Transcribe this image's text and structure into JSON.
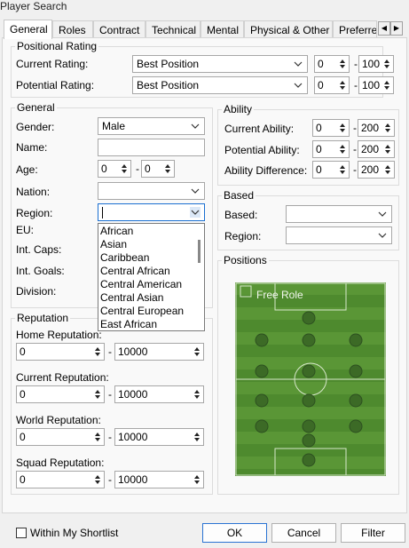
{
  "window": {
    "title": "Player Search"
  },
  "tabs": [
    "General",
    "Roles",
    "Contract",
    "Technical",
    "Mental",
    "Physical & Other",
    "Preferre"
  ],
  "positional_rating": {
    "title": "Positional Rating",
    "current": {
      "label": "Current Rating:",
      "value": "Best Position",
      "min": "0",
      "max": "100"
    },
    "potential": {
      "label": "Potential Rating:",
      "value": "Best Position",
      "min": "0",
      "max": "100"
    }
  },
  "general": {
    "title": "General",
    "gender": {
      "label": "Gender:",
      "value": "Male"
    },
    "name": {
      "label": "Name:",
      "value": ""
    },
    "age": {
      "label": "Age:",
      "min": "0",
      "max": "0"
    },
    "nation": {
      "label": "Nation:",
      "value": ""
    },
    "region": {
      "label": "Region:",
      "value": ""
    },
    "eu": {
      "label": "EU:"
    },
    "int_caps": {
      "label": "Int. Caps:"
    },
    "int_goals": {
      "label": "Int. Goals:"
    },
    "division": {
      "label": "Division:"
    }
  },
  "region_dropdown": [
    "African",
    "Asian",
    "Caribbean",
    "Central African",
    "Central American",
    "Central Asian",
    "Central European",
    "East African"
  ],
  "ability": {
    "title": "Ability",
    "current": {
      "label": "Current Ability:",
      "min": "0",
      "max": "200"
    },
    "potential": {
      "label": "Potential Ability:",
      "min": "0",
      "max": "200"
    },
    "difference": {
      "label": "Ability Difference:",
      "min": "0",
      "max": "200"
    }
  },
  "based": {
    "title": "Based",
    "based": {
      "label": "Based:",
      "value": ""
    },
    "region": {
      "label": "Region:",
      "value": ""
    }
  },
  "positions": {
    "title": "Positions",
    "free_role": "Free Role"
  },
  "reputation": {
    "title": "Reputation",
    "home": {
      "label": "Home Reputation:",
      "min": "0",
      "max": "10000"
    },
    "current": {
      "label": "Current Reputation:",
      "min": "0",
      "max": "10000"
    },
    "world": {
      "label": "World Reputation:",
      "min": "0",
      "max": "10000"
    },
    "squad": {
      "label": "Squad Reputation:",
      "min": "0",
      "max": "10000"
    }
  },
  "footer": {
    "shortlist_label": "Within My Shortlist",
    "ok": "OK",
    "cancel": "Cancel",
    "filter": "Filter"
  },
  "colors": {
    "accent": "#1a6fd1",
    "pitch": "#4e8a2e"
  }
}
